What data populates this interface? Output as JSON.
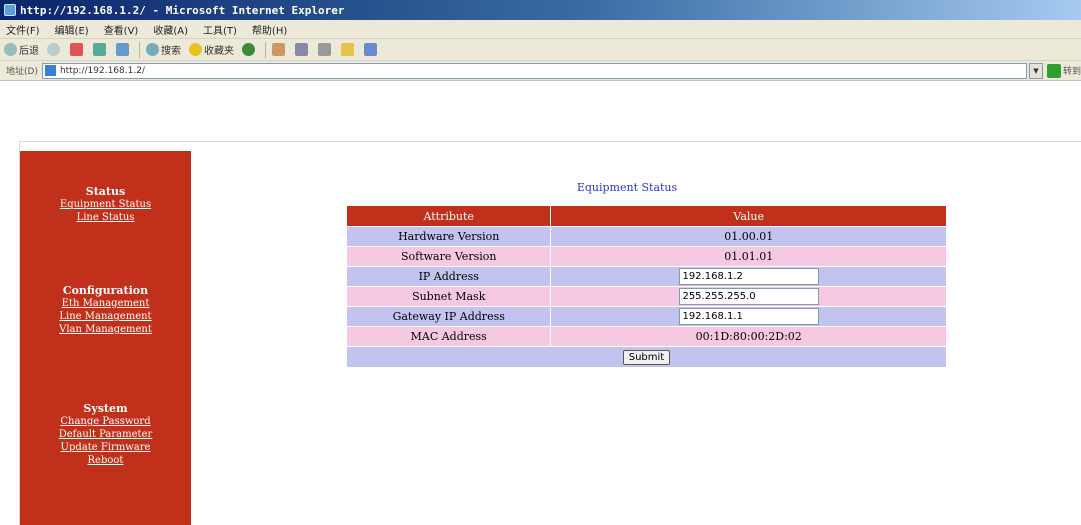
{
  "window": {
    "title": "http://192.168.1.2/ - Microsoft Internet Explorer"
  },
  "menu": [
    "文件(F)",
    "编辑(E)",
    "查看(V)",
    "收藏(A)",
    "工具(T)",
    "帮助(H)"
  ],
  "toolbar": {
    "back": "后退",
    "search": "搜索",
    "favorites": "收藏夹"
  },
  "address": {
    "label": "地址(D)",
    "url": "http://192.168.1.2/",
    "go": "转到"
  },
  "sidebar": {
    "status": {
      "title": "Status",
      "links": [
        "Equipment Status",
        "Line Status"
      ]
    },
    "configuration": {
      "title": "Configuration",
      "links": [
        "Eth Management",
        "Line Management",
        "Vlan Management"
      ]
    },
    "system": {
      "title": "System",
      "links": [
        "Change Password",
        "Default Parameter",
        "Update Firmware",
        "Reboot"
      ]
    }
  },
  "main": {
    "title": "Equipment Status",
    "headers": {
      "attribute": "Attribute",
      "value": "Value"
    },
    "rows": [
      {
        "attribute": "Hardware Version",
        "value": "01.00.01"
      },
      {
        "attribute": "Software Version",
        "value": "01.01.01"
      },
      {
        "attribute": "IP Address",
        "value": "192.168.1.2"
      },
      {
        "attribute": "Subnet Mask",
        "value": "255.255.255.0"
      },
      {
        "attribute": "Gateway IP Address",
        "value": "192.168.1.1"
      },
      {
        "attribute": "MAC Address",
        "value": "00:1D:80:00:2D:02"
      }
    ],
    "submit": "Submit"
  },
  "colors": {
    "accent_red": "#c0301a",
    "row_blue": "#c3c3f0",
    "row_pink": "#f6c8e1",
    "title_blue": "#3333cc"
  }
}
